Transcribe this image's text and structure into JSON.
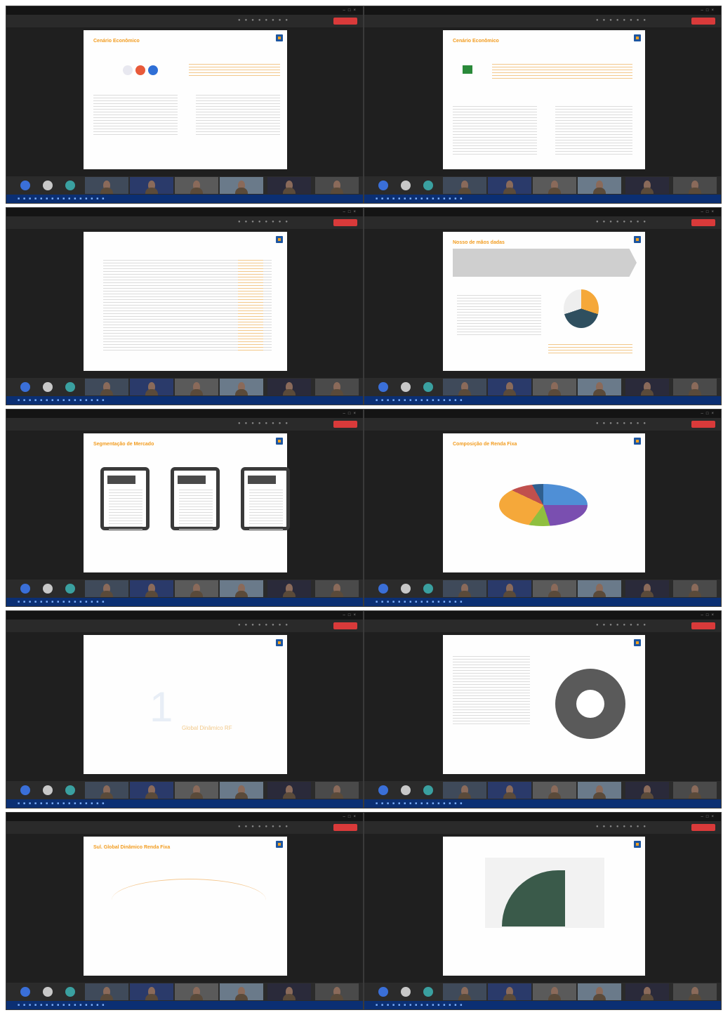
{
  "panels": [
    {
      "slide_title": "Cenário Econômico"
    },
    {
      "slide_title": "Cenário Econômico"
    },
    {
      "slide_title": ""
    },
    {
      "slide_title": "Nosso de mãos dadas"
    },
    {
      "slide_title": "Segmentação de Mercado",
      "box_labels": [
        "Fácil",
        "Sólido",
        "Renda Fixa"
      ]
    },
    {
      "slide_title": "Composição de Renda Fixa"
    },
    {
      "slide_title": "",
      "big_number": "1",
      "subtitle": "Global Dinâmico RF"
    },
    {
      "slide_title": ""
    },
    {
      "slide_title": "Sul. Global Dinâmico Renda Fixa"
    },
    {
      "slide_title": ""
    }
  ],
  "colors": {
    "window_bg": "#1f1f1f",
    "leave_red": "#d93a3a",
    "slide_accent": "#f29c1f",
    "taskbar": "#0b2f73"
  },
  "pie_colors": [
    "#4f8fd6",
    "#7a4fb0",
    "#8fbf3f",
    "#f5a83a",
    "#c0504d",
    "#2f5f8f"
  ]
}
